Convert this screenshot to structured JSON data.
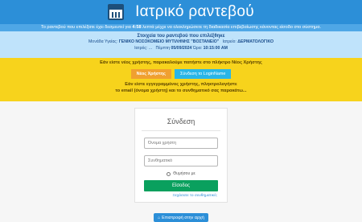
{
  "header": {
    "title": "Ιατρικό ραντεβού",
    "icon": "calendar-icon"
  },
  "timer": {
    "before": "Το ραντεβού που επιλέξατε έχει δεσμευτεί για",
    "remaining": "4:58",
    "after": "λεπτά μέχρι να ολοκληρώσετε τη διαδικασία επιβεβαίωσης κάνοντας είσοδο στο σύστημα."
  },
  "details": {
    "title": "Στοιχεία του ραντεβού που επιλέξθηκε",
    "unit_label": "Μονάδα Υγείας:",
    "unit_value": "ΓΕΝΙΚΟ ΝΟΣΟΚΟΜΕΙΟ ΜΥΤΙΛΗΝΗΣ \"ΒΟΣΤΑΝΕΙΟ\"",
    "specialty_label": "Ιατρείο:",
    "specialty_value": "ΔΕΡΜΑΤΟΛΟΓΙΚΟ",
    "doctor_label": "Ιατρός: ...",
    "date_label": "Πέμπτη",
    "date_value": "05/09/2024",
    "time_label": "Ώρα:",
    "time_value": "10:15:00 AM"
  },
  "new_user": {
    "prompt": "Εάν είστε νέος χρήστης, παρακαλούμε πατήστε στο πλήκτρο Νέος Χρήστης",
    "new_user_button": "Νέος Χρήστης",
    "login_button": "Σύνδεση το LoginName",
    "registered_line1": "Εάν είστε εγγεγραμμένος χρήστης, πληκτρολογήστε",
    "registered_line2": "το email (όνομα χρήστη) και το συνθηματικό σας παρακάτω..."
  },
  "login": {
    "title": "Σύνδεση",
    "username_placeholder": "Όνομα χρήστη",
    "password_placeholder": "Συνθηματικό",
    "remember_label": "Θυμήσου με",
    "submit_label": "Είσοδος",
    "forgot_label": "Ξεχάσατε το συνθηματικό;"
  },
  "footer": {
    "home_button": "Επιστροφή στην αρχή",
    "home_icon": "home-icon"
  },
  "colors": {
    "header": "#2c8fd8",
    "timer_bar": "#4fa7e6",
    "details_bg": "#bfe3fb",
    "notice_bg": "#f7d31c",
    "new_user_button": "#f0a030",
    "login_button": "#29b6e8",
    "submit": "#0aa05e"
  }
}
